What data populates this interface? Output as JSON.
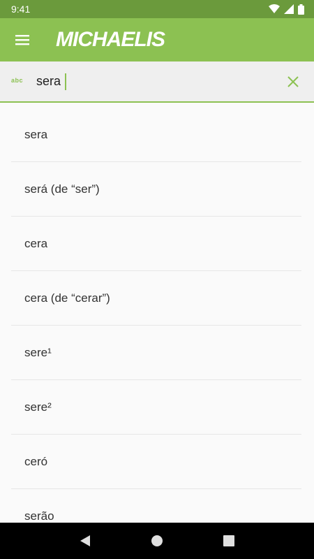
{
  "status": {
    "time": "9:41"
  },
  "app": {
    "title": "MICHAELIS"
  },
  "search": {
    "value": "sera",
    "mode_label": "abc"
  },
  "results": [
    "sera",
    "será (de “ser”)",
    "cera",
    "cera (de “cerar”)",
    "sere¹",
    "sere²",
    "ceró",
    "serão"
  ],
  "icons": {
    "menu": "hamburger-menu",
    "clear": "close",
    "back": "triangle-back",
    "home": "circle-home",
    "recents": "square-recents"
  },
  "colors": {
    "accent": "#8cc152",
    "status_bar": "#6b9a3c"
  }
}
